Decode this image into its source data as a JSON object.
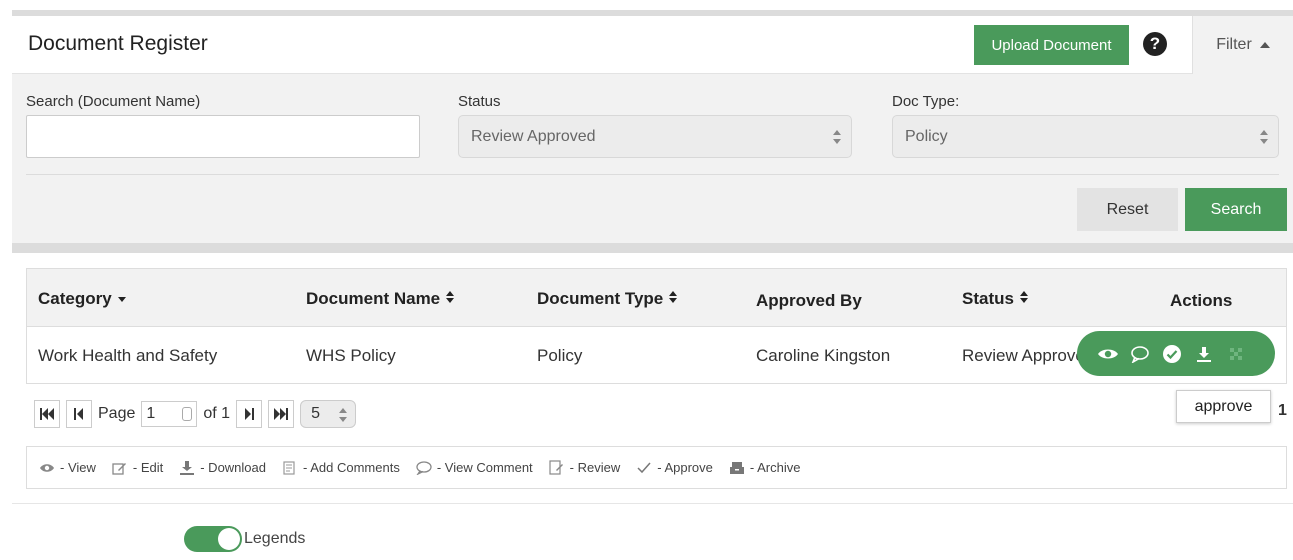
{
  "header": {
    "title": "Document Register",
    "upload_label": "Upload Document",
    "help_glyph": "?",
    "filter_label": "Filter"
  },
  "filters": {
    "search_label": "Search (Document Name)",
    "search_value": "",
    "status_label": "Status",
    "status_value": "Review Approved",
    "doctype_label": "Doc Type:",
    "doctype_value": "Policy",
    "reset_label": "Reset",
    "search_button_label": "Search"
  },
  "table": {
    "headers": {
      "category": "Category",
      "document_name": "Document Name",
      "document_type": "Document Type",
      "approved_by": "Approved By",
      "status": "Status",
      "actions": "Actions"
    },
    "rows": [
      {
        "category": "Work Health and Safety",
        "document_name": "WHS Policy",
        "document_type": "Policy",
        "approved_by": "Caroline Kingston",
        "status": "Review Approved"
      }
    ],
    "row_actions": [
      "eye-icon",
      "comment-icon",
      "approve-check-icon",
      "download-icon",
      "archive-icon"
    ]
  },
  "tooltip": {
    "text": "approve"
  },
  "right_number": "1",
  "pager": {
    "page_label": "Page",
    "page_value": "1",
    "of_label": "of 1",
    "page_size": "5"
  },
  "legend": {
    "view": "- View",
    "edit": "- Edit",
    "download": "- Download",
    "add_comments": "- Add Comments",
    "view_comment": "- View Comment",
    "review": "- Review",
    "approve": "- Approve",
    "archive": "- Archive"
  },
  "legends_toggle": {
    "label": "Legends",
    "on": true
  },
  "colors": {
    "accent": "#4a9a5b",
    "panel": "#f2f2f2",
    "border": "#dddddd"
  }
}
